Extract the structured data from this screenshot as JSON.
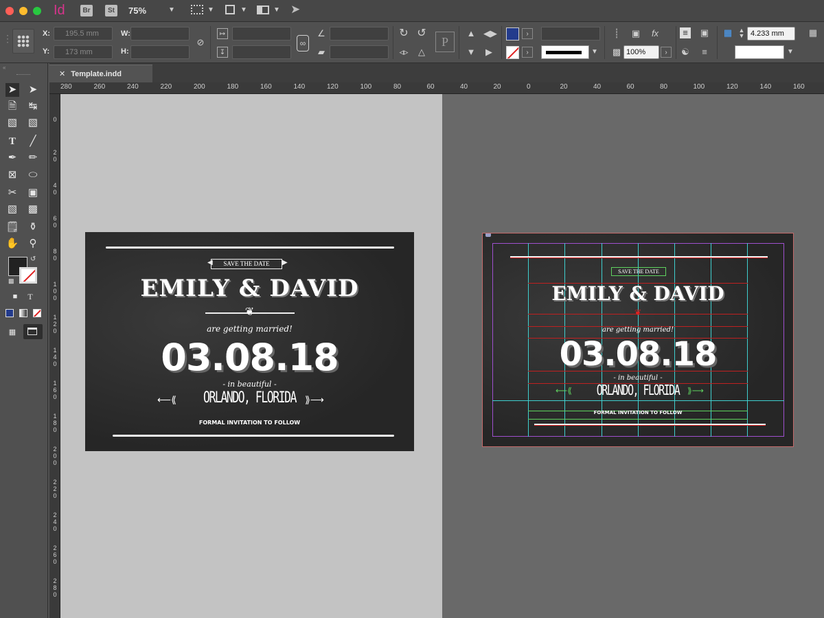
{
  "app": {
    "name": "Id",
    "bridge": "Br",
    "stock": "St",
    "zoom": "75%"
  },
  "control": {
    "x_label": "X:",
    "y_label": "Y:",
    "w_label": "W:",
    "h_label": "H:",
    "x_value": "195.5 mm",
    "y_value": "173 mm",
    "scale_value": "100%",
    "stroke_weight": "4.233 mm",
    "fill_color": "#233b8c"
  },
  "document": {
    "tab_title": "Template.indd"
  },
  "ruler": {
    "h_ticks": [
      "280",
      "260",
      "240",
      "220",
      "200",
      "180",
      "160",
      "140",
      "120",
      "100",
      "80",
      "60",
      "40",
      "20",
      "0",
      "20",
      "40",
      "60",
      "80",
      "100",
      "120",
      "140",
      "160"
    ],
    "v_ticks": [
      "0",
      "2\n0",
      "4\n0",
      "6\n0",
      "8\n0",
      "1\n0\n0",
      "1\n2\n0",
      "1\n4\n0",
      "1\n6\n0",
      "1\n8\n0",
      "2\n0\n0",
      "2\n2\n0",
      "2\n4\n0",
      "2\n6\n0",
      "2\n8\n0"
    ]
  },
  "card": {
    "badge": "SAVE THE DATE",
    "names": "EMILY & DAVID",
    "subtitle": "are getting married!",
    "date": "03.08.18",
    "in_beautiful": "- in beautiful -",
    "location": "ORLANDO, FLORIDA",
    "footer": "FORMAL INVITATION TO FOLLOW"
  },
  "card_preview": {
    "badge": "SAVE THE DATE",
    "names": "EMILY & DAVID",
    "subtitle": "are getting married!",
    "date": "03.08.18",
    "in_beautiful": "- in beautiful -",
    "location": "ORLANDO, FLORIDA",
    "footer": "FORMAL INVITATION TO FOLLOW"
  },
  "colors": {
    "guide_cyan": "#3fd0d0",
    "guide_red": "#d02020",
    "guide_green": "#5fd35f",
    "margin_purple": "#a050d0"
  }
}
